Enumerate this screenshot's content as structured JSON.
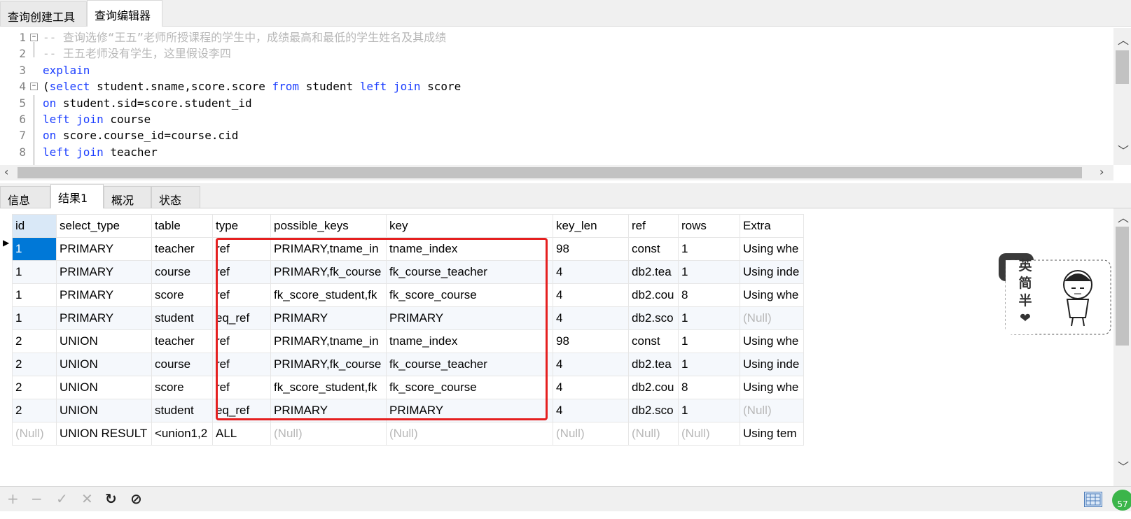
{
  "top_tabs": [
    {
      "label": "查询创建工具"
    },
    {
      "label": "查询编辑器"
    }
  ],
  "editor": {
    "lines": [
      {
        "num": "1",
        "parts": [
          {
            "t": "-- 查询选修“王五”老师所授课程的学生中，成绩最高和最低的学生姓名及其成绩",
            "c": "cm"
          }
        ]
      },
      {
        "num": "2",
        "parts": [
          {
            "t": "-- 王五老师没有学生，这里假设李四",
            "c": "cm"
          }
        ]
      },
      {
        "num": "3",
        "parts": [
          {
            "t": "explain",
            "c": "kw"
          }
        ]
      },
      {
        "num": "4",
        "parts": [
          {
            "t": "(",
            "c": ""
          },
          {
            "t": "select",
            "c": "kw"
          },
          {
            "t": " student.sname,score.score ",
            "c": ""
          },
          {
            "t": "from",
            "c": "kw"
          },
          {
            "t": " student ",
            "c": ""
          },
          {
            "t": "left join",
            "c": "kw"
          },
          {
            "t": " score",
            "c": ""
          }
        ]
      },
      {
        "num": "5",
        "parts": [
          {
            "t": "on",
            "c": "kw"
          },
          {
            "t": " student.sid=score.student_id",
            "c": ""
          }
        ]
      },
      {
        "num": "6",
        "parts": [
          {
            "t": "left join",
            "c": "kw"
          },
          {
            "t": " course",
            "c": ""
          }
        ]
      },
      {
        "num": "7",
        "parts": [
          {
            "t": "on",
            "c": "kw"
          },
          {
            "t": " score.course_id=course.cid",
            "c": ""
          }
        ]
      },
      {
        "num": "8",
        "parts": [
          {
            "t": "left join",
            "c": "kw"
          },
          {
            "t": " teacher",
            "c": ""
          }
        ]
      }
    ]
  },
  "result_tabs": [
    {
      "label": "信息"
    },
    {
      "label": "结果1"
    },
    {
      "label": "概况"
    },
    {
      "label": "状态"
    }
  ],
  "grid": {
    "columns": [
      "id",
      "select_type",
      "table",
      "type",
      "possible_keys",
      "key",
      "key_len",
      "ref",
      "rows",
      "Extra"
    ],
    "rows": [
      [
        "1",
        "PRIMARY",
        "teacher",
        "ref",
        "PRIMARY,tname_in",
        "tname_index",
        "98",
        "const",
        "1",
        "Using whe"
      ],
      [
        "1",
        "PRIMARY",
        "course",
        "ref",
        "PRIMARY,fk_course",
        "fk_course_teacher",
        "4",
        "db2.tea",
        "1",
        "Using inde"
      ],
      [
        "1",
        "PRIMARY",
        "score",
        "ref",
        "fk_score_student,fk",
        "fk_score_course",
        "4",
        "db2.cou",
        "8",
        "Using whe"
      ],
      [
        "1",
        "PRIMARY",
        "student",
        "eq_ref",
        "PRIMARY",
        "PRIMARY",
        "4",
        "db2.sco",
        "1",
        "(Null)"
      ],
      [
        "2",
        "UNION",
        "teacher",
        "ref",
        "PRIMARY,tname_in",
        "tname_index",
        "98",
        "const",
        "1",
        "Using whe"
      ],
      [
        "2",
        "UNION",
        "course",
        "ref",
        "PRIMARY,fk_course",
        "fk_course_teacher",
        "4",
        "db2.tea",
        "1",
        "Using inde"
      ],
      [
        "2",
        "UNION",
        "score",
        "ref",
        "fk_score_student,fk",
        "fk_score_course",
        "4",
        "db2.cou",
        "8",
        "Using whe"
      ],
      [
        "2",
        "UNION",
        "student",
        "eq_ref",
        "PRIMARY",
        "PRIMARY",
        "4",
        "db2.sco",
        "1",
        "(Null)"
      ],
      [
        "(Null)",
        "UNION RESULT",
        "<union1,2",
        "ALL",
        "(Null)",
        "(Null)",
        "(Null)",
        "(Null)",
        "(Null)",
        "Using tem"
      ]
    ]
  },
  "toolbar": {
    "items": [
      {
        "name": "add-row-icon",
        "glyph": "+"
      },
      {
        "name": "delete-row-icon",
        "glyph": "−"
      },
      {
        "name": "apply-icon",
        "glyph": "✓"
      },
      {
        "name": "cancel-icon",
        "glyph": "✕"
      },
      {
        "name": "refresh-icon",
        "glyph": "↻"
      },
      {
        "name": "stop-icon",
        "glyph": "⊘"
      }
    ]
  },
  "sticker": {
    "text": [
      "英",
      "简",
      "半",
      "❤"
    ]
  },
  "badge": {
    "text": "57"
  },
  "colors": {
    "keyword": "#1e40ff",
    "comment": "#b8b8b8",
    "highlight": "#e52020",
    "selection": "#0078d7"
  }
}
